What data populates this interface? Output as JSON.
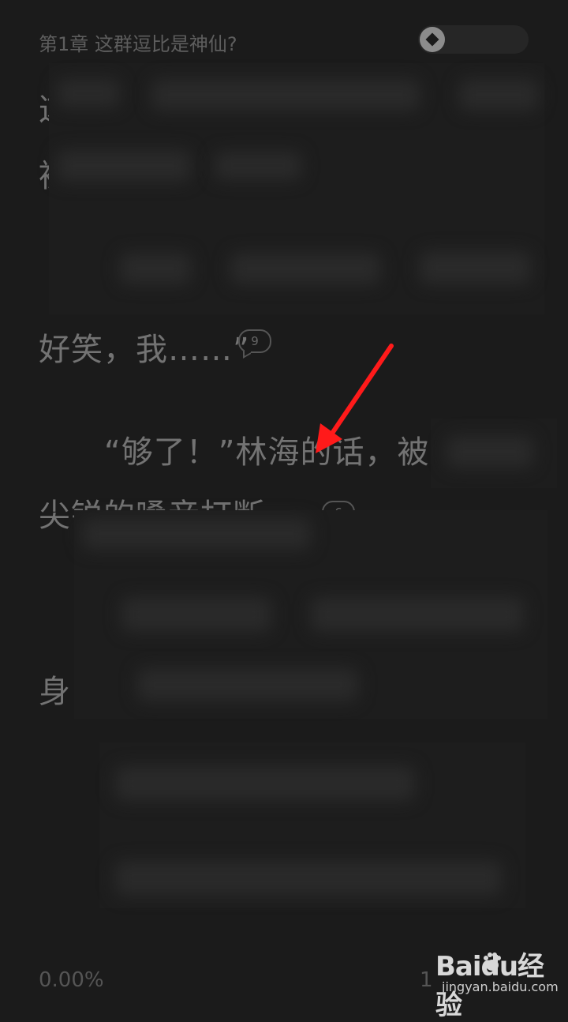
{
  "header": {
    "chapter_title": "第1章 这群逗比是神仙?"
  },
  "content": {
    "lines": [
      {
        "text": "这",
        "comment_count": null
      },
      {
        "text": "被",
        "comment_count": null
      },
      {
        "text": "好笑，我……”",
        "comment_count": "9"
      },
      {
        "text": "“够了！”林海的话，被",
        "comment_count": null
      },
      {
        "text": "尖锐的嗓音打断。",
        "comment_count": "6"
      },
      {
        "text": "身",
        "comment_count": null
      }
    ]
  },
  "footer": {
    "progress": "0.00%",
    "page": "1"
  },
  "watermark": {
    "brand": "Baidu经验",
    "url": "jingyan.baidu.com"
  },
  "colors": {
    "background": "#1b1b1b",
    "text": "#737373",
    "annotation_arrow": "#ff1a1a"
  }
}
